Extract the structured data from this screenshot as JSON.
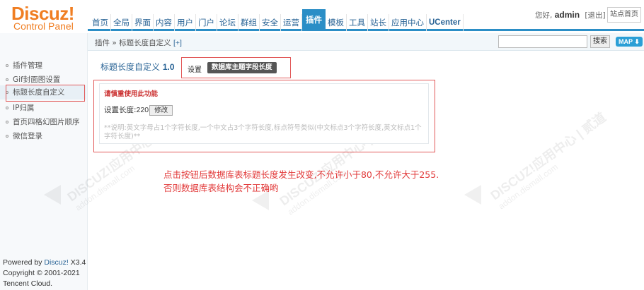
{
  "logo": {
    "title": "Discuz!",
    "subtitle": "Control Panel"
  },
  "nav": [
    "首页",
    "全局",
    "界面",
    "内容",
    "用户",
    "门户",
    "论坛",
    "群组",
    "安全",
    "运营",
    "插件",
    "模板",
    "工具",
    "站长",
    "应用中心",
    "UCenter"
  ],
  "nav_active": "插件",
  "user": {
    "greeting": "您好,",
    "name": "admin",
    "logout": "[退出]",
    "home": "站点首页"
  },
  "breadcrumb": {
    "path": "插件 » 标题长度自定义",
    "add": "[+]"
  },
  "search": {
    "button": "搜索",
    "map": "MAP ⬇"
  },
  "sidebar": {
    "items": [
      "插件管理",
      "Gif封面图设置",
      "标题长度自定义",
      "IP归属",
      "首页四格幻图片顺序",
      "微信登录"
    ],
    "active_index": 2
  },
  "footer": {
    "line1_prefix": "Powered by ",
    "brand": "Discuz!",
    "version": " X3.4",
    "line2": "Copyright © 2001-2021",
    "line3": "Tencent Cloud."
  },
  "plugin": {
    "name": "标题长度自定义",
    "version": "1.0"
  },
  "tabs": {
    "settings": "设置",
    "active": "数据库主题字段长度"
  },
  "panel": {
    "warning": "请慎重使用此功能",
    "field_label": "设置长度:",
    "field_value": "220",
    "button": "修改",
    "tip": "**说明:英文字母占1个字符长度,一个中文占3个字符长度,标点符号类似(中文标点3个字符长度,英文标点1个字符长度)**"
  },
  "note": {
    "line1": "点击按钮后数据库表标题长度发生改变,不允许小于80,不允许大于255.",
    "line2": "否则数据库表结构会不正确哟"
  },
  "watermark": {
    "brand": "DISCUZ!应用中心 | 贰道",
    "url": "addon.dismall.com"
  }
}
